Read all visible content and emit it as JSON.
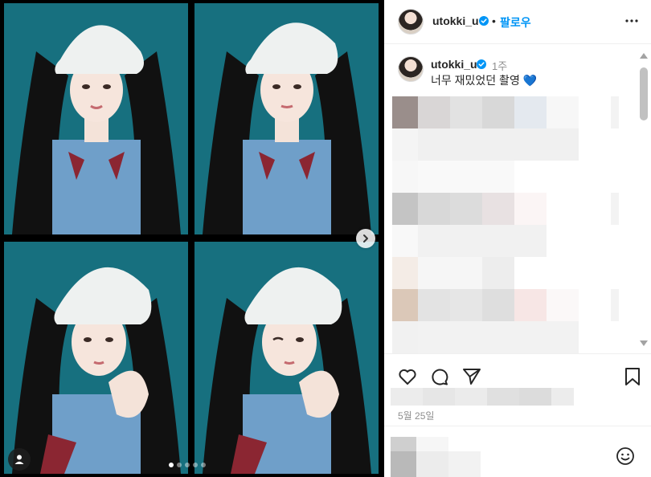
{
  "post": {
    "photo_alt": "photo grid",
    "carousel": {
      "dot_count": 5,
      "active_index": 0
    },
    "media_controls": {
      "next_icon": "chevron-right-icon",
      "tagged_users_icon": "user-icon"
    }
  },
  "header": {
    "username": "utokki_u",
    "separator": "•",
    "follow_label": "팔로우",
    "more_icon": "more-horizontal-icon"
  },
  "caption": {
    "username": "utokki_u",
    "time_ago": "1주",
    "text": "너무 재밌었던 촬영",
    "emoji": "💙"
  },
  "actions": {
    "like_icon": "heart-icon",
    "comment_icon": "comment-icon",
    "share_icon": "send-icon",
    "save_icon": "bookmark-icon"
  },
  "date_label": "5월 25일",
  "comment_box": {
    "emoji_icon": "smiley-icon"
  },
  "colors": {
    "accent": "#0095f6",
    "verified": "#0095f6",
    "photo_background": "#1a6f7f",
    "muted_text": "#8e8e8e"
  }
}
